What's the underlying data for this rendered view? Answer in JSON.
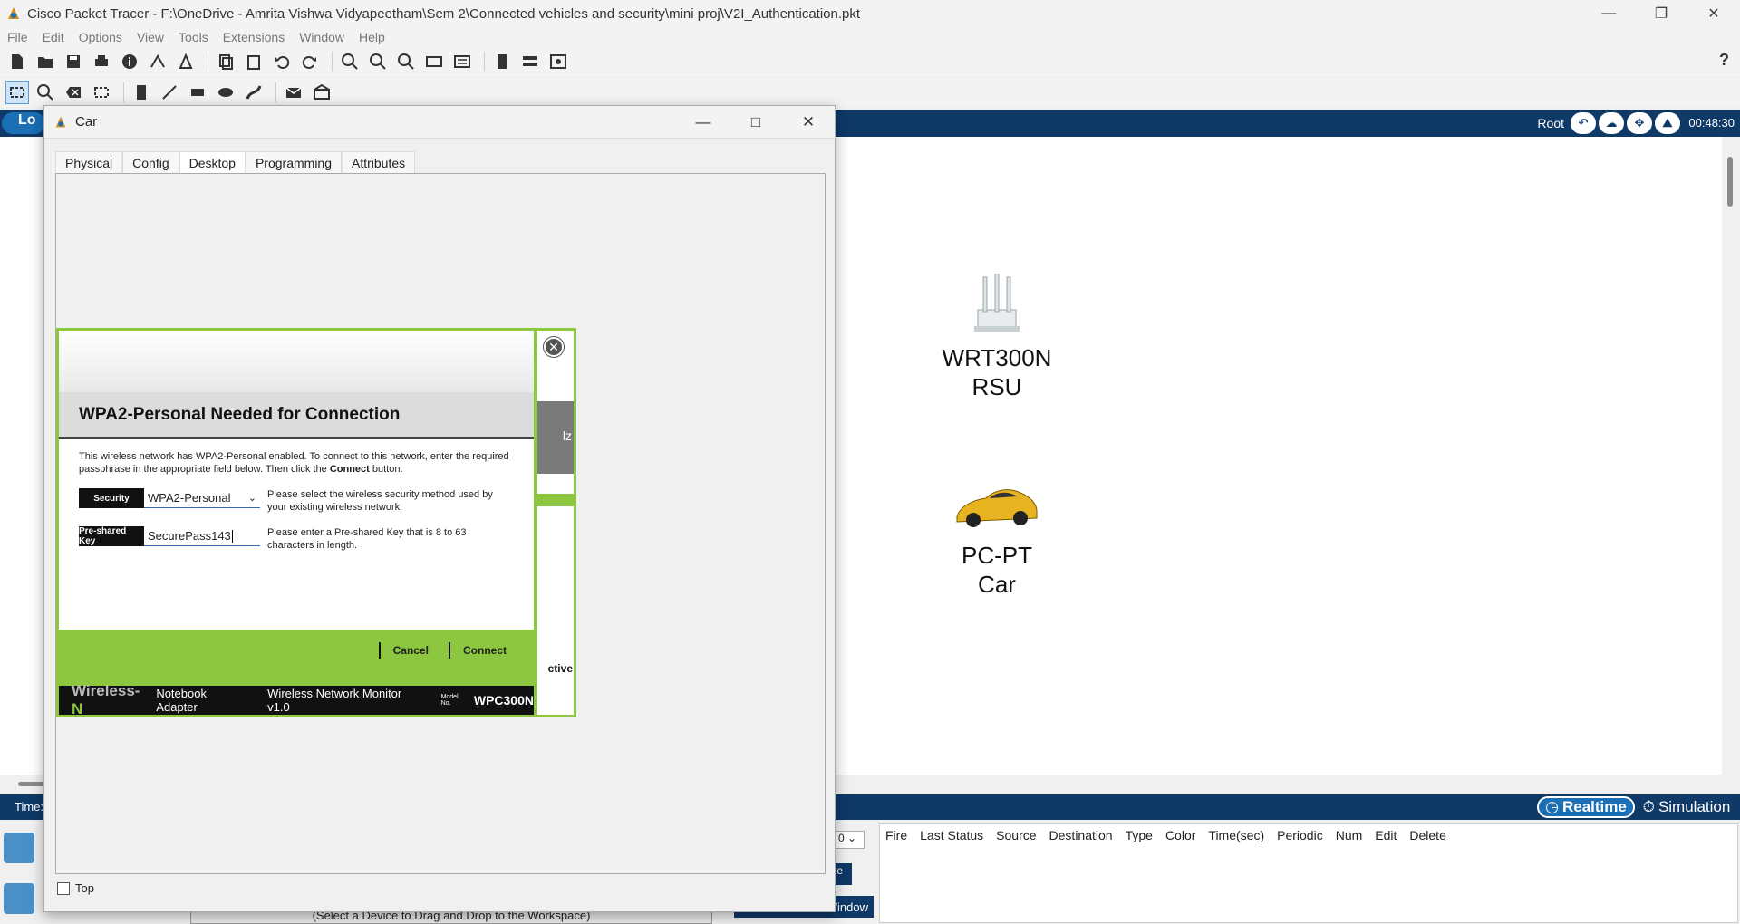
{
  "app": {
    "title": "Cisco Packet Tracer - F:\\OneDrive - Amrita Vishwa Vidyapeetham\\Sem 2\\Connected vehicles and security\\mini proj\\V2I_Authentication.pkt",
    "menu": [
      "File",
      "Edit",
      "Options",
      "View",
      "Tools",
      "Extensions",
      "Window",
      "Help"
    ],
    "help_label": "?"
  },
  "logical": {
    "tab_label": "Lo",
    "root_label": "Root",
    "clock": "00:48:30"
  },
  "devices": [
    {
      "model": "WRT300N",
      "name": "RSU"
    },
    {
      "model": "PC-PT",
      "name": "Car"
    }
  ],
  "bottom": {
    "time_label": "Time:",
    "realtime_label": "Realtime",
    "simulation_label": "Simulation",
    "scenario_value": "0",
    "btn_fragment": "te",
    "window_btn_label": "Window",
    "device_hint": "(Select a Device to Drag and Drop to the Workspace)",
    "pdu_columns": [
      "Fire",
      "Last Status",
      "Source",
      "Destination",
      "Type",
      "Color",
      "Time(sec)",
      "Periodic",
      "Num",
      "Edit",
      "Delete"
    ]
  },
  "car_window": {
    "title": "Car",
    "tabs": [
      "Physical",
      "Config",
      "Desktop",
      "Programming",
      "Attributes"
    ],
    "active_tab": "Desktop",
    "top_checkbox_label": "Top"
  },
  "wpa_dialog": {
    "heading": "WPA2-Personal Needed for Connection",
    "description_part1": "This wireless network has WPA2-Personal enabled. To connect to this network, enter the required passphrase in the appropriate field below. Then click the ",
    "description_bold": "Connect",
    "description_part2": " button.",
    "security_label": "Security",
    "security_value": "WPA2-Personal",
    "security_help": "Please select the wireless security method used by your existing wireless network.",
    "key_label": "Pre-shared Key",
    "key_value": "SecurePass143",
    "key_help": "Please enter a Pre-shared Key that is 8 to 63 characters in length.",
    "cancel_label": "Cancel",
    "connect_label": "Connect",
    "brand_wireless": "Wireless-",
    "brand_n": "N",
    "product": "Notebook Adapter",
    "monitor": "Wireless Network Monitor  v1.0",
    "model_no_label": "Model No.",
    "model": "WPC300N",
    "behind_fragment_1": "lz",
    "behind_fragment_2": "ctive"
  },
  "colors": {
    "linksys_green": "#8dc63f",
    "pt_navy": "#0f3966",
    "pt_blue": "#1b6fb5"
  }
}
